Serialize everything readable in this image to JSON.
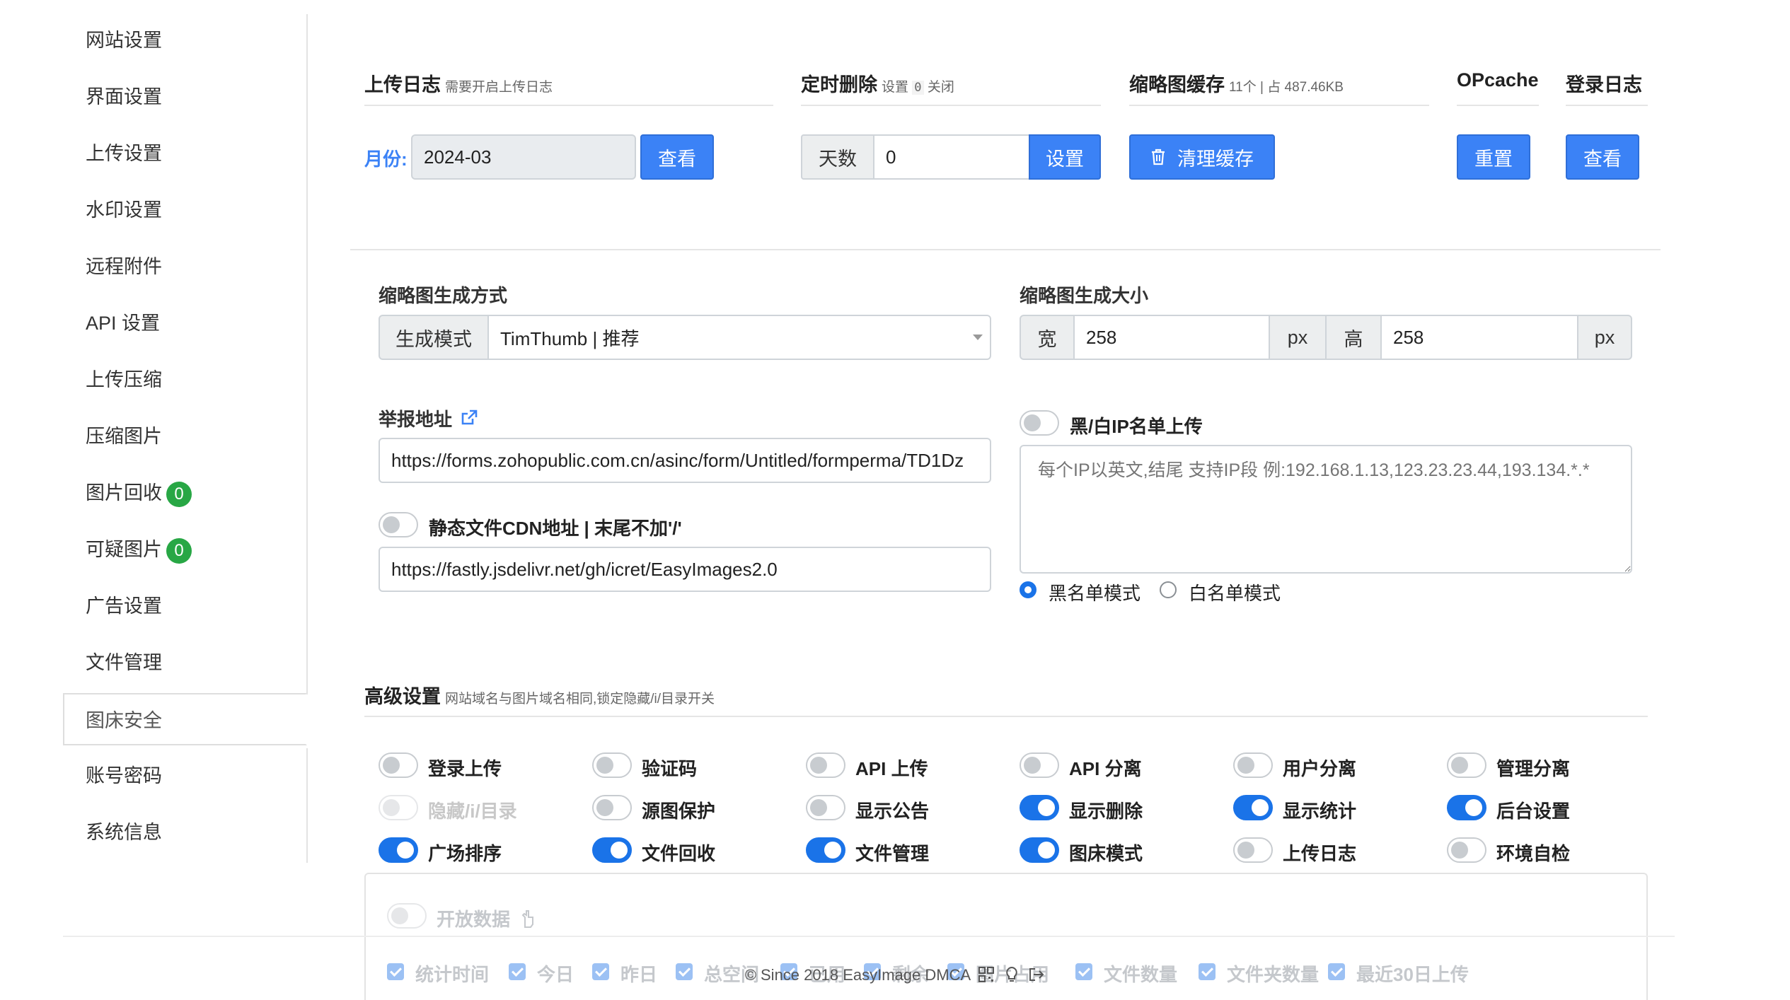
{
  "sidebar": {
    "items": [
      {
        "label": "网站设置"
      },
      {
        "label": "界面设置"
      },
      {
        "label": "上传设置"
      },
      {
        "label": "水印设置"
      },
      {
        "label": "远程附件"
      },
      {
        "label": "API 设置"
      },
      {
        "label": "上传压缩"
      },
      {
        "label": "压缩图片"
      },
      {
        "label": "图片回收",
        "badge": "0"
      },
      {
        "label": "可疑图片",
        "badge": "0"
      },
      {
        "label": "广告设置"
      },
      {
        "label": "文件管理"
      },
      {
        "label": "图床安全",
        "active": true
      },
      {
        "label": "账号密码"
      },
      {
        "label": "系统信息"
      }
    ],
    "badge_color": "#28a745"
  },
  "upload_log": {
    "title": "上传日志",
    "hint": "需要开启上传日志",
    "month_label": "月份:",
    "month_value": "2024-03",
    "view_btn": "查看"
  },
  "timed_delete": {
    "title": "定时删除",
    "hint_pre": "设置",
    "hint_code": "0",
    "hint_post": "关闭",
    "days_label": "天数",
    "days_value": "0",
    "set_btn": "设置"
  },
  "thumb_cache": {
    "title": "缩略图缓存",
    "hint": "11个 | 占 487.46KB",
    "clear_btn": "清理缓存"
  },
  "opcache": {
    "title": "OPcache",
    "reset_btn": "重置"
  },
  "login_log": {
    "title": "登录日志",
    "view_btn": "查看"
  },
  "thumb_method": {
    "label": "缩略图生成方式",
    "addon": "生成模式",
    "value": "TimThumb | 推荐"
  },
  "thumb_size": {
    "label": "缩略图生成大小",
    "width_label": "宽",
    "width_value": "258",
    "height_label": "高",
    "height_value": "258",
    "unit": "px"
  },
  "report": {
    "label": "举报地址",
    "value": "https://forms.zohopublic.com.cn/asinc/form/Untitled/formperma/TD1Dz"
  },
  "cdn": {
    "label": "静态文件CDN地址 | 末尾不加'/'",
    "value": "https://fastly.jsdelivr.net/gh/icret/EasyImages2.0"
  },
  "ip_list": {
    "label": "黑/白IP名单上传",
    "placeholder": "每个IP以英文,结尾 支持IP段 例:192.168.1.13,123.23.23.44,193.134.*.*",
    "black_mode": "黑名单模式",
    "white_mode": "白名单模式"
  },
  "advanced": {
    "title": "高级设置",
    "hint": "网站域名与图片域名相同,锁定隐藏/i/目录开关",
    "toggles": [
      {
        "label": "登录上传",
        "on": false
      },
      {
        "label": "验证码",
        "on": false
      },
      {
        "label": "API 上传",
        "on": false
      },
      {
        "label": "API 分离",
        "on": false
      },
      {
        "label": "用户分离",
        "on": false
      },
      {
        "label": "管理分离",
        "on": false
      },
      {
        "label": "隐藏/i/目录",
        "on": false,
        "disabled": true
      },
      {
        "label": "源图保护",
        "on": false
      },
      {
        "label": "显示公告",
        "on": false
      },
      {
        "label": "显示删除",
        "on": true
      },
      {
        "label": "显示统计",
        "on": true
      },
      {
        "label": "后台设置",
        "on": true
      },
      {
        "label": "广场排序",
        "on": true
      },
      {
        "label": "文件回收",
        "on": true
      },
      {
        "label": "文件管理",
        "on": true
      },
      {
        "label": "图床模式",
        "on": true
      },
      {
        "label": "上传日志",
        "on": false
      },
      {
        "label": "环境自检",
        "on": false
      }
    ],
    "open_data_label": "开放数据",
    "checkboxes": [
      "统计时间",
      "今日",
      "昨日",
      "总空间",
      "已用",
      "剩余",
      "图片占用",
      "文件数量",
      "文件夹数量",
      "最近30日上传"
    ]
  },
  "footer": {
    "text": "© Since 2018 EasyImage DMCA"
  },
  "colors": {
    "primary": "#3b82f6",
    "toggle_on": "#1a73e8"
  }
}
